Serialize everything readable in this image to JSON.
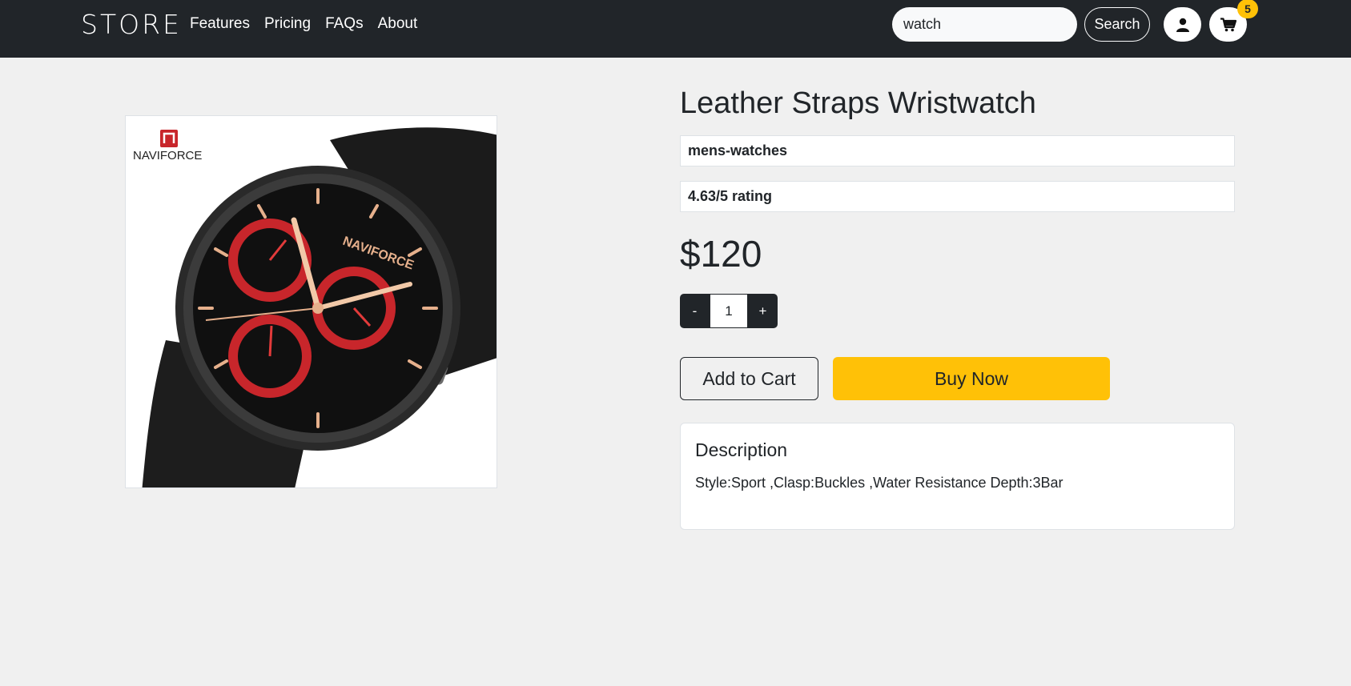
{
  "navbar": {
    "brand": "STORE",
    "links": [
      "Features",
      "Pricing",
      "FAQs",
      "About"
    ],
    "search_value": "watch",
    "search_button": "Search",
    "cart_count": "5",
    "user_icon": "user-icon",
    "cart_icon": "cart-icon",
    "background": "#212529"
  },
  "product": {
    "image_brand_logo": "NAVIFORCE",
    "title": "Leather Straps Wristwatch",
    "category": "mens-watches",
    "rating": "4.63/5 rating",
    "price": "$120",
    "quantity": {
      "minus": "-",
      "value": "1",
      "plus": "+"
    },
    "add_to_cart": "Add to Cart",
    "buy_now": "Buy Now",
    "description": {
      "heading": "Description",
      "text": "Style:Sport ,Clasp:Buckles ,Water Resistance Depth:3Bar"
    }
  },
  "colors": {
    "accent": "#ffc107",
    "dark": "#212529",
    "page_bg": "#f0f0f0"
  }
}
